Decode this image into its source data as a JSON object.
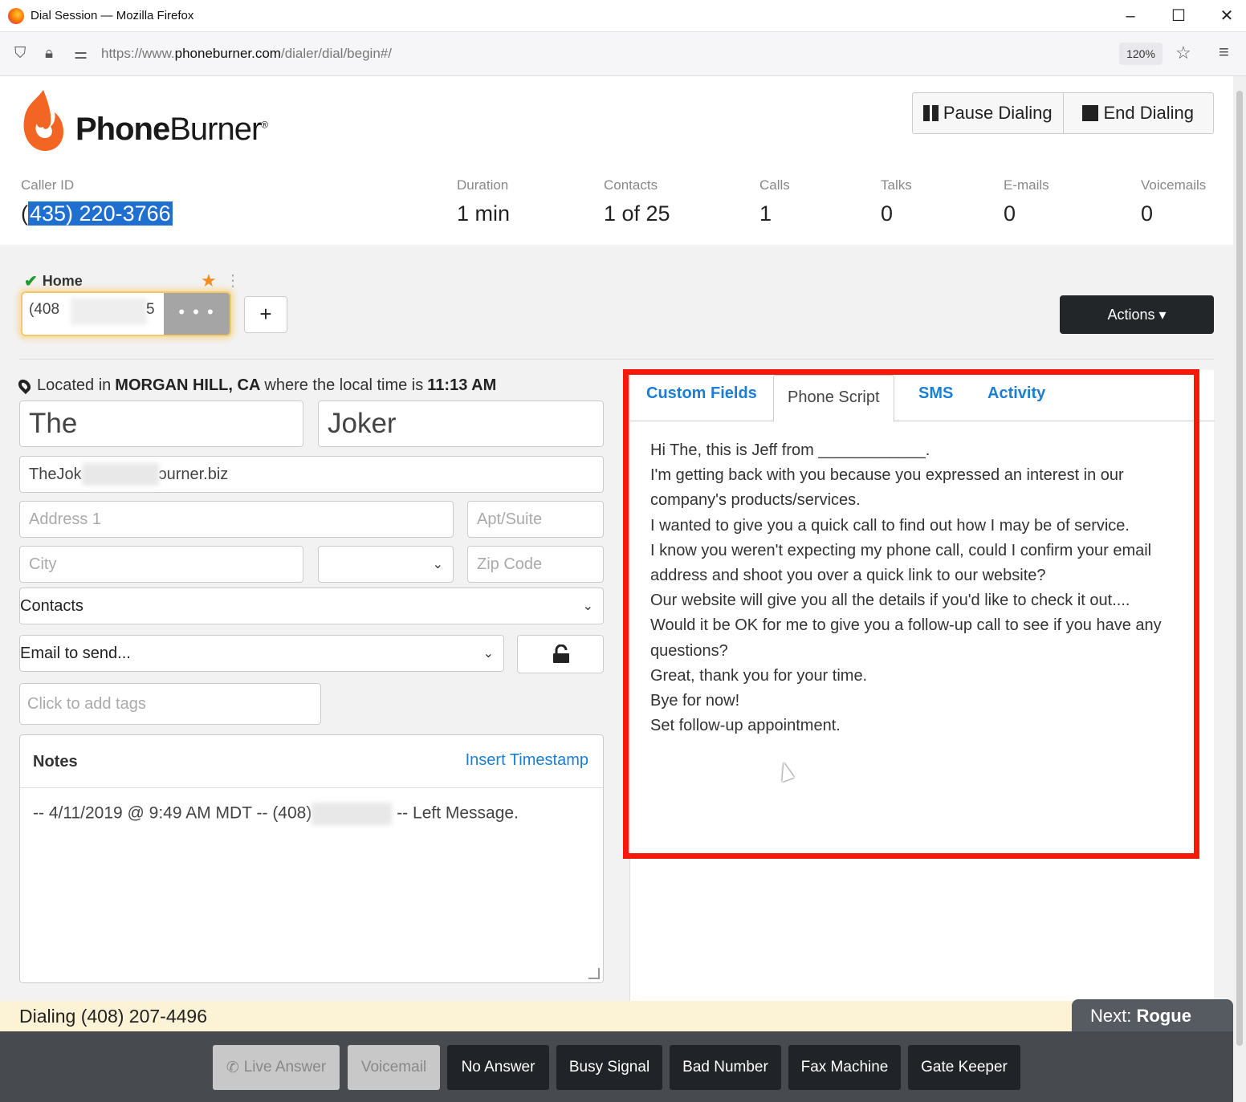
{
  "browser": {
    "window_title": "Dial Session — Mozilla Firefox",
    "url_prefix": "https://www.",
    "url_domain": "phoneburner.com",
    "url_path": "/dialer/dial/begin#/",
    "zoom": "120%"
  },
  "brand": {
    "name_bold": "Phone",
    "name_light": "Burner",
    "trademark": "®"
  },
  "dial_controls": {
    "pause_label": "Pause Dialing",
    "end_label": "End Dialing"
  },
  "stats": {
    "caller_id_label": "Caller ID",
    "caller_id_prefix": "(",
    "caller_id_value": "435) 220-3766",
    "duration_label": "Duration",
    "duration_value": "1 min",
    "contacts_label": "Contacts",
    "contacts_value": "1 of 25",
    "calls_label": "Calls",
    "calls_value": "1",
    "talks_label": "Talks",
    "talks_value": "0",
    "emails_label": "E-mails",
    "emails_value": "0",
    "voicemails_label": "Voicemails",
    "voicemails_value": "0"
  },
  "phone": {
    "type_label": "Home",
    "number_visible": "(408",
    "number_tail": "5",
    "more_label": "• • •",
    "add_label": "+"
  },
  "actions_label": "Actions ▾",
  "location": {
    "prefix": "Located in",
    "city": "MORGAN HILL, CA",
    "middle": "where the local time is",
    "time": "11:13 AM"
  },
  "contact_form": {
    "first_name": "The",
    "last_name": "Joker",
    "email_start": "TheJok",
    "email_end": "ɔurner.biz",
    "address1_placeholder": "Address 1",
    "apt_placeholder": "Apt/Suite",
    "city_placeholder": "City",
    "state_value": "",
    "zip_placeholder": "Zip Code",
    "folder_value": "Contacts",
    "email_template_value": "Email to send...",
    "tags_placeholder": "Click to add tags"
  },
  "notes": {
    "title": "Notes",
    "insert_timestamp": "Insert Timestamp",
    "entry_start": "-- 4/11/2019 @ 9:49 AM MDT -- (408)",
    "entry_end": "-- Left Message."
  },
  "tabs": [
    {
      "label": "Custom Fields"
    },
    {
      "label": "Phone Script"
    },
    {
      "label": "SMS"
    },
    {
      "label": "Activity"
    }
  ],
  "script_lines": [
    "Hi The, this is Jeff from ____________.",
    "I'm getting back with you because you expressed an interest in our",
    "company's products/services.",
    "I wanted to give you a quick call to find out how I may be of service.",
    "I know you weren't expecting my phone call, could I confirm your email",
    "address and shoot you over a quick link to our website?",
    "Our website will give you all the details if you'd like to check it out....",
    "Would it be OK for me to give you a follow-up call to see if you have any",
    "questions?",
    "Great, thank you for your time.",
    "Bye for now!",
    "Set follow-up appointment."
  ],
  "dialing_status": "Dialing (408) 207-4496",
  "next": {
    "prefix": "Next:",
    "name": "Rogue"
  },
  "outcomes": {
    "live_answer": "Live Answer",
    "voicemail": "Voicemail",
    "no_answer": "No Answer",
    "busy_signal": "Busy Signal",
    "bad_number": "Bad Number",
    "fax_machine": "Fax Machine",
    "gate_keeper": "Gate Keeper"
  },
  "colors": {
    "brand_orange": "#f26522",
    "link_blue": "#1a7fd4",
    "highlight_red": "#f5190c",
    "dark_button": "#202327"
  }
}
